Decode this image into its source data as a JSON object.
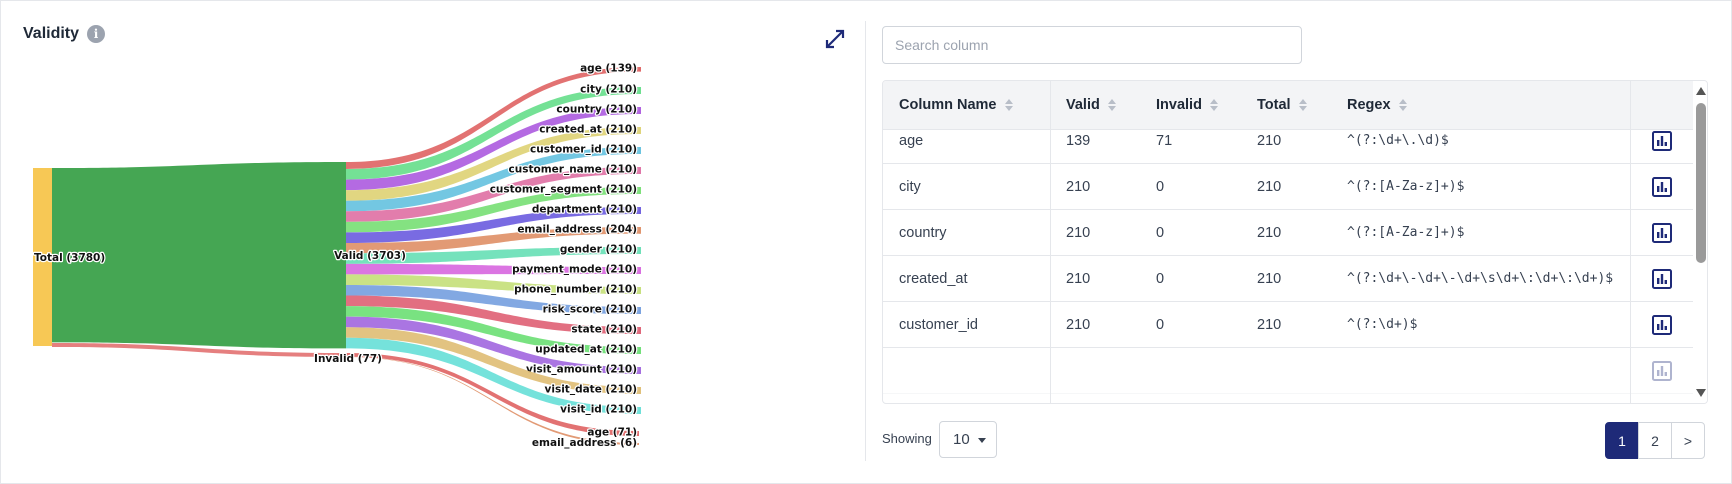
{
  "panel": {
    "title": "Validity",
    "info_icon": "info-icon",
    "expand_icon": "expand-arrows-icon"
  },
  "sankey": {
    "source": {
      "label": "Total (3780)",
      "value": 3780,
      "color": "#f7c855"
    },
    "valid": {
      "label": "Valid (3703)",
      "value": 3703,
      "color": "#45a653"
    },
    "invalid": {
      "label": "Invalid (77)",
      "value": 77,
      "color": "#e27171"
    },
    "valid_targets": [
      {
        "label": "age (139)",
        "value": 139,
        "color": "#e06a6a"
      },
      {
        "label": "city (210)",
        "value": 210,
        "color": "#6ddf8f"
      },
      {
        "label": "country (210)",
        "value": 210,
        "color": "#b062e0"
      },
      {
        "label": "created_at (210)",
        "value": 210,
        "color": "#dfd47a"
      },
      {
        "label": "customer_id (210)",
        "value": 210,
        "color": "#6bc4e0"
      },
      {
        "label": "customer_name (210)",
        "value": 210,
        "color": "#e076a8"
      },
      {
        "label": "customer_segment (210)",
        "value": 210,
        "color": "#7de07a"
      },
      {
        "label": "department (210)",
        "value": 210,
        "color": "#7263e0"
      },
      {
        "label": "email_address (204)",
        "value": 204,
        "color": "#e0956e"
      },
      {
        "label": "gender (210)",
        "value": 210,
        "color": "#6ee0b8"
      },
      {
        "label": "payment_mode (210)",
        "value": 210,
        "color": "#d96ee0"
      },
      {
        "label": "phone_number (210)",
        "value": 210,
        "color": "#c7e07e"
      },
      {
        "label": "risk_score (210)",
        "value": 210,
        "color": "#7ba3e0"
      },
      {
        "label": "state (210)",
        "value": 210,
        "color": "#e0677a"
      },
      {
        "label": "updated_at (210)",
        "value": 210,
        "color": "#72e07a"
      },
      {
        "label": "visit_amount (210)",
        "value": 210,
        "color": "#a56ee0"
      },
      {
        "label": "visit_date (210)",
        "value": 210,
        "color": "#e0c07a"
      },
      {
        "label": "visit_id (210)",
        "value": 210,
        "color": "#6ee0d9"
      }
    ],
    "invalid_targets": [
      {
        "label": "age (71)",
        "value": 71,
        "color": "#e06a6a"
      },
      {
        "label": "email_address (6)",
        "value": 6,
        "color": "#e0956e"
      }
    ]
  },
  "search": {
    "placeholder": "Search column",
    "value": ""
  },
  "table": {
    "headers": [
      "Column Name",
      "Valid",
      "Invalid",
      "Total",
      "Regex"
    ],
    "rows": [
      {
        "name": "age",
        "valid": "139",
        "invalid": "71",
        "total": "210",
        "regex": "^(?:\\d+\\.\\d)$"
      },
      {
        "name": "city",
        "valid": "210",
        "invalid": "0",
        "total": "210",
        "regex": "^(?:[A-Za-z]+)$"
      },
      {
        "name": "country",
        "valid": "210",
        "invalid": "0",
        "total": "210",
        "regex": "^(?:[A-Za-z]+)$"
      },
      {
        "name": "created_at",
        "valid": "210",
        "invalid": "0",
        "total": "210",
        "regex": "^(?:\\d+\\-\\d+\\-\\d+\\s\\d+\\:\\d+\\:\\d+)$"
      },
      {
        "name": "customer_id",
        "valid": "210",
        "invalid": "0",
        "total": "210",
        "regex": "^(?:\\d+)$"
      }
    ],
    "row_icon": "bar-chart-icon",
    "accent": "#1e2a78"
  },
  "footer": {
    "showing_label": "Showing",
    "page_size": "10",
    "pages": [
      "1",
      "2"
    ],
    "next_label": ">",
    "active_page": "1"
  }
}
